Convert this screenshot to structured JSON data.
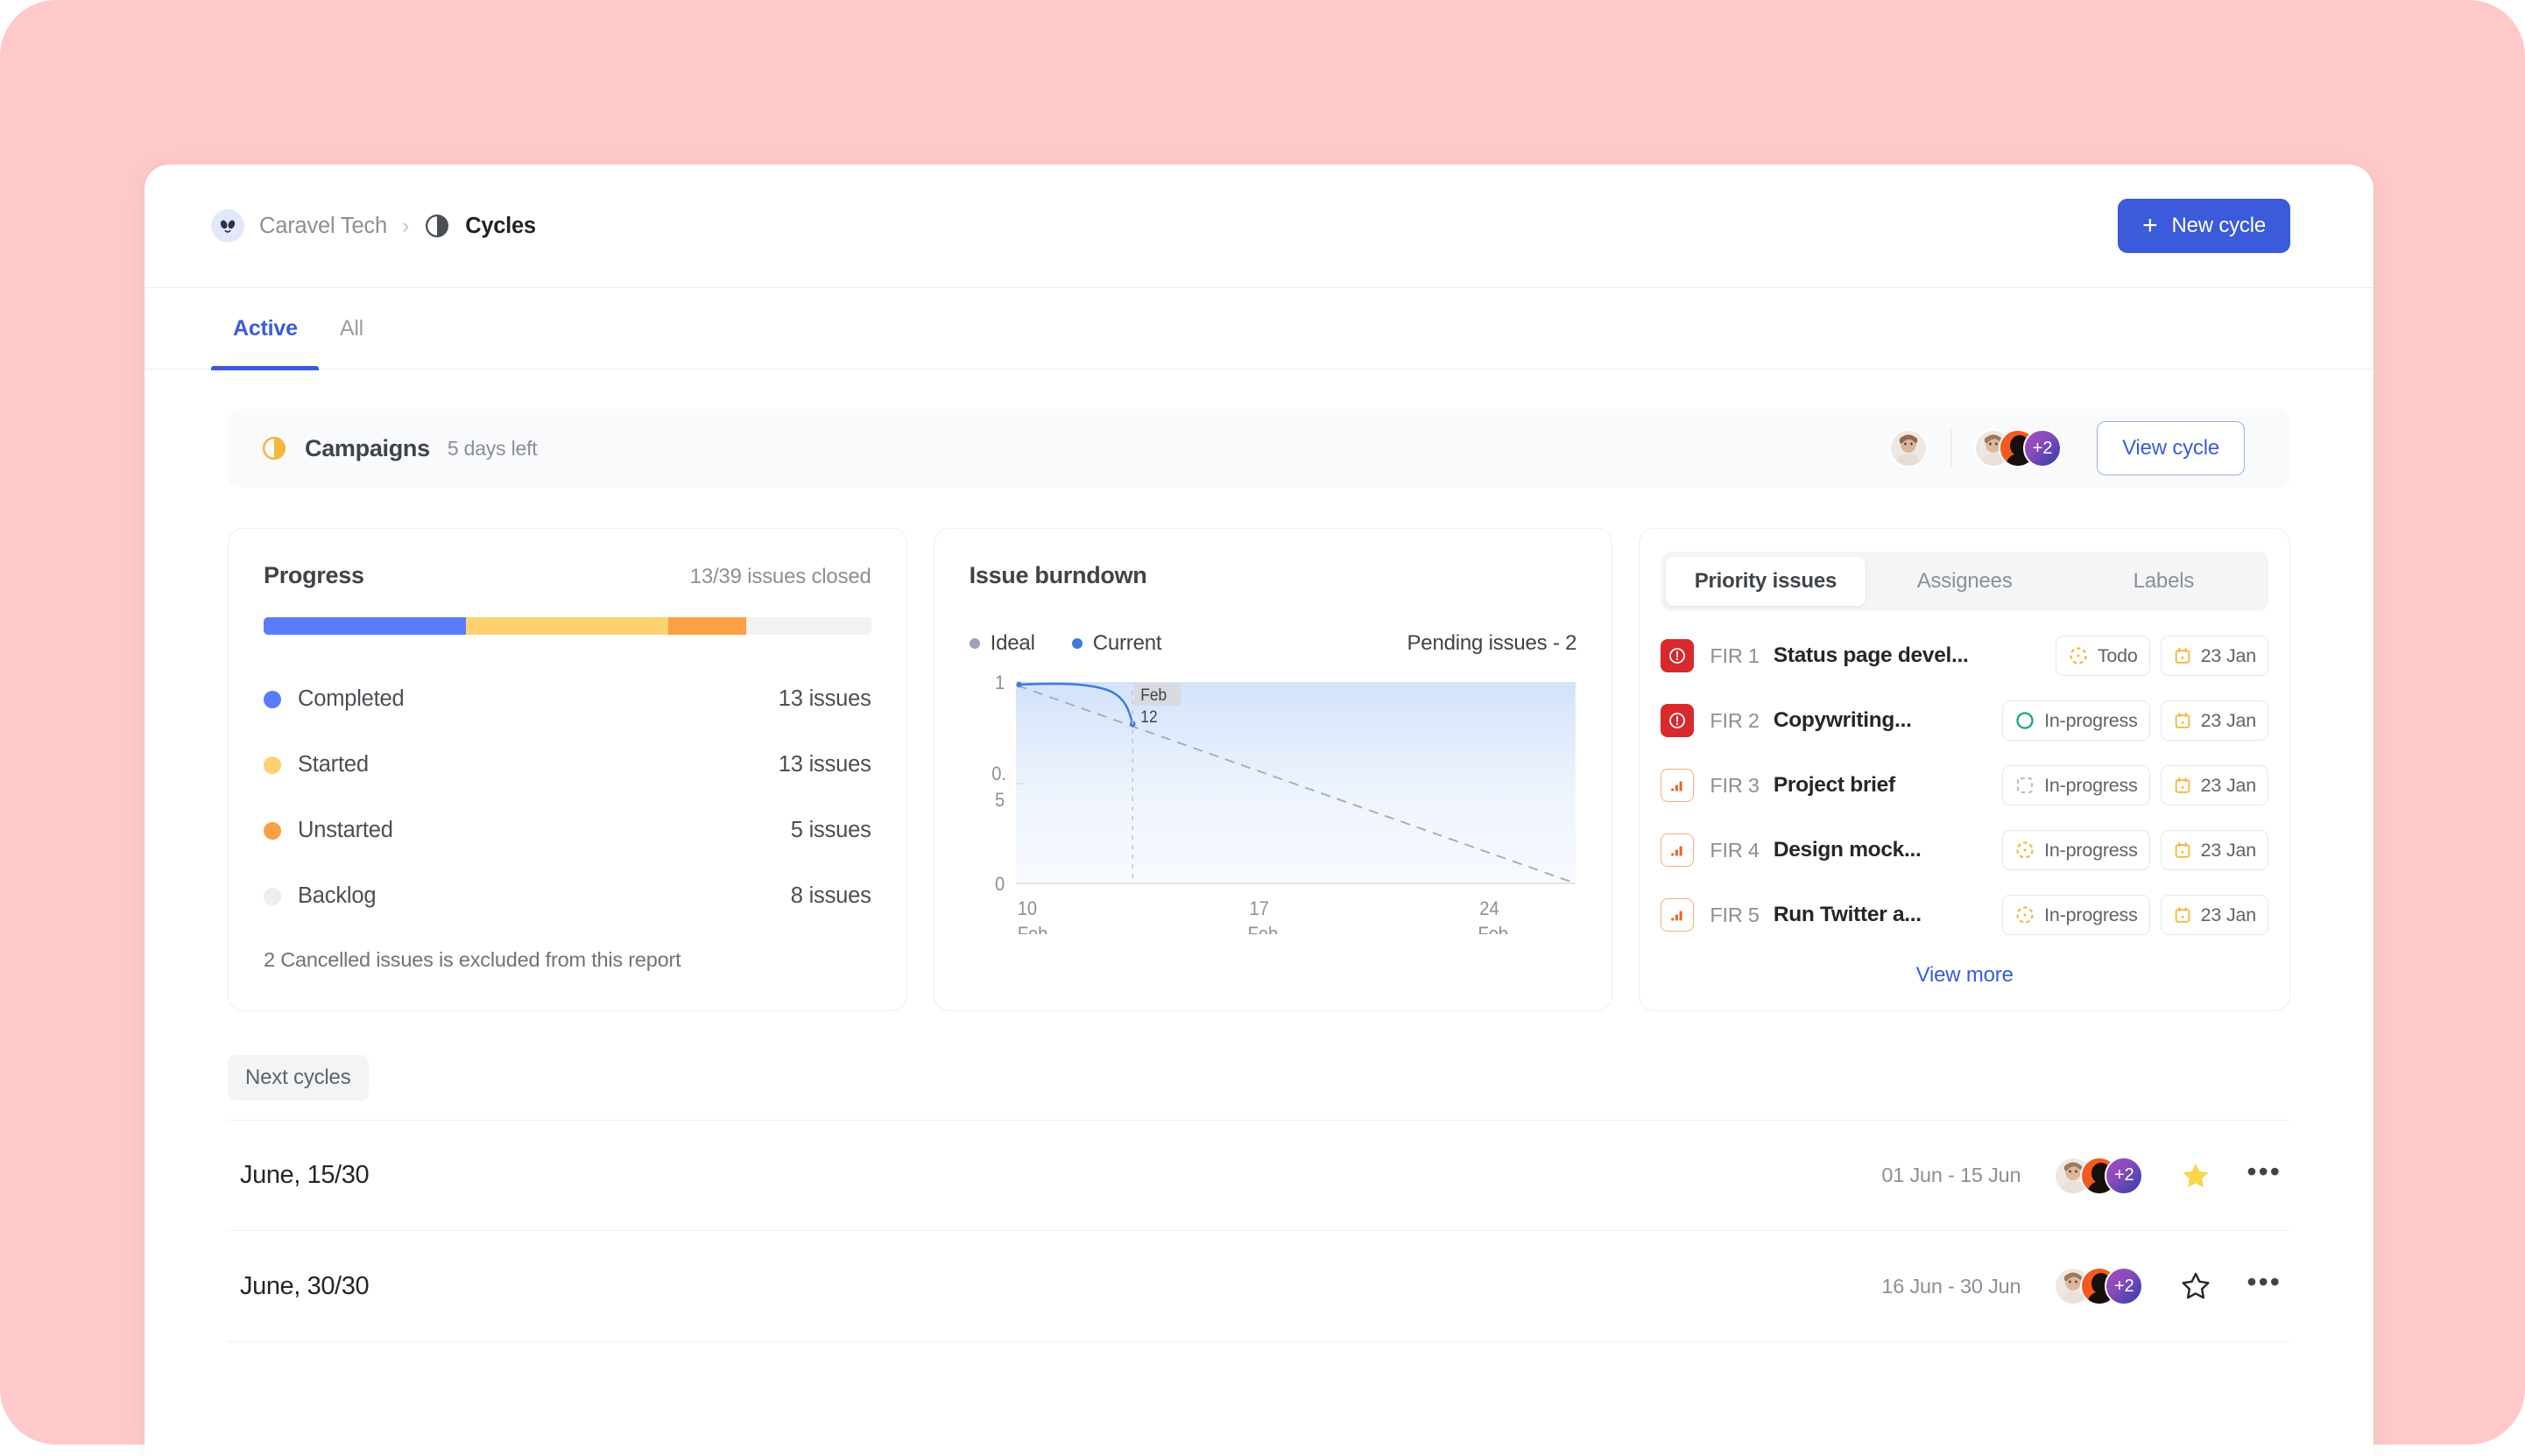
{
  "breadcrumb": {
    "workspace": "Caravel Tech",
    "separator": "›",
    "current": "Cycles",
    "workspace_icon": "alien-logo-icon",
    "current_icon": "cycle-contrast-icon"
  },
  "header": {
    "new_cycle_label": "New cycle",
    "new_cycle_plus": "+",
    "accent_color": "#3b5bdb"
  },
  "tabs": [
    {
      "label": "Active",
      "active": true
    },
    {
      "label": "All",
      "active": false
    }
  ],
  "banner": {
    "title": "Campaigns",
    "subtitle": "5 days left",
    "status_icon": "cycle-half-filled-icon",
    "status_color": "#f5b73c",
    "extra_members": "+2",
    "view_cycle_label": "View cycle"
  },
  "progress": {
    "title": "Progress",
    "meta": "13/39 issues closed",
    "bar": [
      {
        "color": "#5b7cfa",
        "pct": 33.3
      },
      {
        "color": "#ffd271",
        "pct": 33.3
      },
      {
        "color": "#fba043",
        "pct": 12.8
      },
      {
        "color": "#f1f2f4",
        "pct": 20.6
      }
    ],
    "rows": [
      {
        "label": "Completed",
        "value": "13 issues",
        "color": "#5b7cfa"
      },
      {
        "label": "Started",
        "value": "13 issues",
        "color": "#ffd271"
      },
      {
        "label": "Unstarted",
        "value": "5 issues",
        "color": "#fba043"
      },
      {
        "label": "Backlog",
        "value": "8 issues",
        "color": "#eceef0"
      }
    ],
    "note": "2 Cancelled issues is excluded from this report"
  },
  "burndown": {
    "title": "Issue burndown",
    "legend": [
      {
        "label": "Ideal",
        "color": "#9aa3b8"
      },
      {
        "label": "Current",
        "color": "#3b7ddd"
      }
    ],
    "pending": "Pending issues - 2",
    "tooltip_line1": "Feb",
    "tooltip_line2": "12"
  },
  "chart_data": {
    "type": "line",
    "title": "Issue burndown",
    "xlabel": "",
    "ylabel": "",
    "ylim": [
      0,
      1
    ],
    "yticks": [
      0,
      0.5,
      1
    ],
    "ytick_labels": [
      "0",
      "0.5",
      "1"
    ],
    "x_tick_labels": [
      [
        "10",
        "Feb"
      ],
      [
        "17",
        "Feb"
      ],
      [
        "24",
        "Feb"
      ]
    ],
    "x_tick_values": [
      10,
      17,
      24
    ],
    "xlim": [
      10,
      27
    ],
    "grid": false,
    "legend_position": "top-left",
    "annotation": {
      "text": "Feb 12",
      "x": 12,
      "y": 0.85
    },
    "series": [
      {
        "name": "Ideal",
        "style": "dashed",
        "color": "#9aa3b8",
        "x": [
          10,
          27
        ],
        "values": [
          1.0,
          0.0
        ]
      },
      {
        "name": "Current",
        "style": "solid-area",
        "color": "#3b7ddd",
        "x": [
          10,
          10.8,
          11.4,
          11.8,
          12
        ],
        "values": [
          1.0,
          1.0,
          0.99,
          0.94,
          0.85
        ]
      }
    ]
  },
  "issues_panel": {
    "tabs": [
      {
        "label": "Priority issues",
        "active": true
      },
      {
        "label": "Assignees",
        "active": false
      },
      {
        "label": "Labels",
        "active": false
      }
    ],
    "rows": [
      {
        "priority": "urgent",
        "key": "FIR 1",
        "title": "Status page devel...",
        "state": "Todo",
        "state_icon": "todo-dashed-circle-icon",
        "state_color": "#f5b73c",
        "date": "23 Jan"
      },
      {
        "priority": "urgent",
        "key": "FIR 2",
        "title": "Copywriting...",
        "state": "In-progress",
        "state_icon": "in-progress-green-circle-icon",
        "state_color": "#19a974",
        "date": "23 Jan"
      },
      {
        "priority": "high",
        "key": "FIR 3",
        "title": "Project brief",
        "state": "In-progress",
        "state_icon": "backlog-dashed-square-icon",
        "state_color": "#b6bbc2",
        "date": "23 Jan"
      },
      {
        "priority": "high",
        "key": "FIR 4",
        "title": "Design mock...",
        "state": "In-progress",
        "state_icon": "todo-dashed-circle-icon",
        "state_color": "#f5b73c",
        "date": "23 Jan"
      },
      {
        "priority": "high",
        "key": "FIR 5",
        "title": "Run Twitter a...",
        "state": "In-progress",
        "state_icon": "todo-dashed-circle-icon",
        "state_color": "#f5b73c",
        "date": "23 Jan"
      }
    ],
    "view_more": "View more"
  },
  "next_cycles": {
    "label": "Next cycles",
    "rows": [
      {
        "name": "June, 15/30",
        "dates": "01 Jun - 15 Jun",
        "extra_members": "+2",
        "starred": true
      },
      {
        "name": "June, 30/30",
        "dates": "16 Jun - 30 Jun",
        "extra_members": "+2",
        "starred": false
      }
    ]
  }
}
